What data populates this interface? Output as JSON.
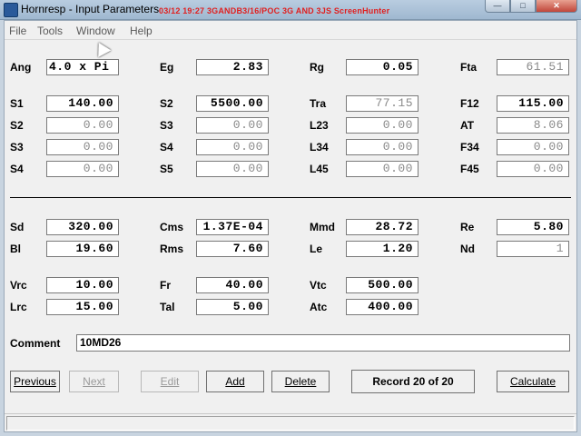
{
  "window": {
    "title": "Hornresp - Input Parameters",
    "overlay": "03/12  19:27  3GANDB3/16/POC  3G AND 3JS  ScreenHunter",
    "minimize": "—",
    "maximize": "□",
    "close": "✕"
  },
  "menu": [
    "File",
    "Tools",
    "Window",
    "Help"
  ],
  "fields": {
    "ang": {
      "label": "Ang",
      "value": "4.0 x Pi"
    },
    "eg": {
      "label": "Eg",
      "value": "2.83"
    },
    "rg": {
      "label": "Rg",
      "value": "0.05"
    },
    "fta": {
      "label": "Fta",
      "value": "61.51"
    },
    "s1a": {
      "label": "S1",
      "value": "140.00"
    },
    "s2a": {
      "label": "S2",
      "value": "5500.00"
    },
    "tra": {
      "label": "Tra",
      "value": "77.15"
    },
    "f12": {
      "label": "F12",
      "value": "115.00"
    },
    "s2b": {
      "label": "S2",
      "value": "0.00"
    },
    "s3a": {
      "label": "S3",
      "value": "0.00"
    },
    "l23": {
      "label": "L23",
      "value": "0.00"
    },
    "at": {
      "label": "AT",
      "value": "8.06"
    },
    "s3b": {
      "label": "S3",
      "value": "0.00"
    },
    "s4a": {
      "label": "S4",
      "value": "0.00"
    },
    "l34": {
      "label": "L34",
      "value": "0.00"
    },
    "f34": {
      "label": "F34",
      "value": "0.00"
    },
    "s4b": {
      "label": "S4",
      "value": "0.00"
    },
    "s5": {
      "label": "S5",
      "value": "0.00"
    },
    "l45": {
      "label": "L45",
      "value": "0.00"
    },
    "f45": {
      "label": "F45",
      "value": "0.00"
    },
    "sd": {
      "label": "Sd",
      "value": "320.00"
    },
    "cms": {
      "label": "Cms",
      "value": "1.37E-04"
    },
    "mmd": {
      "label": "Mmd",
      "value": "28.72"
    },
    "re": {
      "label": "Re",
      "value": "5.80"
    },
    "bl": {
      "label": "Bl",
      "value": "19.60"
    },
    "rms": {
      "label": "Rms",
      "value": "7.60"
    },
    "le": {
      "label": "Le",
      "value": "1.20"
    },
    "nd": {
      "label": "Nd",
      "value": "1"
    },
    "vrc": {
      "label": "Vrc",
      "value": "10.00"
    },
    "fr": {
      "label": "Fr",
      "value": "40.00"
    },
    "vtc": {
      "label": "Vtc",
      "value": "500.00"
    },
    "lrc": {
      "label": "Lrc",
      "value": "15.00"
    },
    "tal": {
      "label": "Tal",
      "value": "5.00"
    },
    "atc": {
      "label": "Atc",
      "value": "400.00"
    }
  },
  "comment": {
    "label": "Comment",
    "value": "10MD26"
  },
  "buttons": {
    "previous": "Previous",
    "next": "Next",
    "edit": "Edit",
    "add": "Add",
    "delete": "Delete",
    "calculate": "Calculate"
  },
  "record": "Record 20 of 20",
  "colors": {
    "title_overlay": "#e02020",
    "window_frame": "#c8d4e0",
    "disabled_text": "#8a8a8a"
  }
}
